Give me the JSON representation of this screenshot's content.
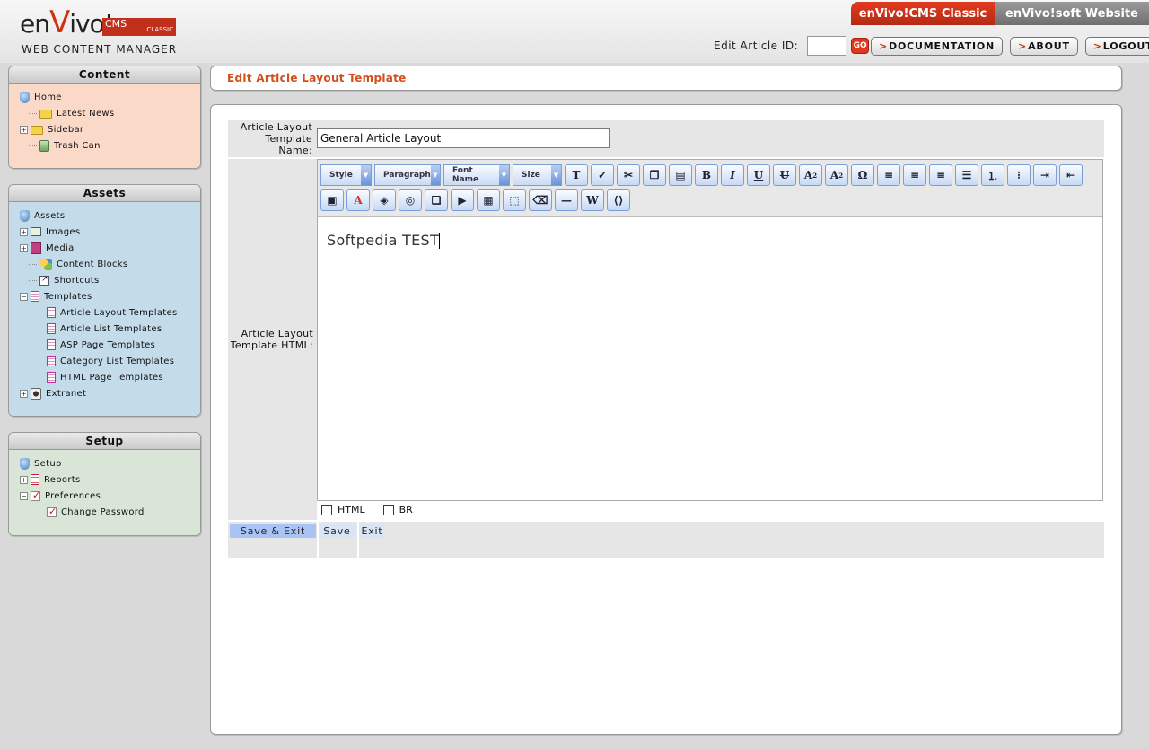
{
  "header": {
    "logo_brand_prefix": "en",
    "logo_brand_v": "V",
    "logo_brand_suffix": "ivo!",
    "logo_cms": "CMS",
    "logo_classic": "CLASSIC",
    "logo_subtitle": "WEB CONTENT MANAGER",
    "site_tabs": [
      "enVivo!CMS Classic",
      "enVivo!soft Website"
    ],
    "edit_article_label": "Edit Article ID:",
    "edit_article_value": "",
    "go_label": "GO",
    "nav_buttons": [
      "DOCUMENTATION",
      "ABOUT",
      "LOGOUT"
    ],
    "nav_arrow": ">"
  },
  "sidebar": {
    "content": {
      "title": "Content",
      "items": [
        "Home",
        "Latest News",
        "Sidebar",
        "Trash Can"
      ]
    },
    "assets": {
      "title": "Assets",
      "items": [
        "Assets",
        "Images",
        "Media",
        "Content Blocks",
        "Shortcuts",
        "Templates",
        "Article Layout Templates",
        "Article List Templates",
        "ASP Page Templates",
        "Category List Templates",
        "HTML Page Templates",
        "Extranet"
      ]
    },
    "setup": {
      "title": "Setup",
      "items": [
        "Setup",
        "Reports",
        "Preferences",
        "Change Password"
      ]
    }
  },
  "main": {
    "title": "Edit Article Layout Template",
    "name_label": "Article Layout Template Name:",
    "name_value": "General Article Layout",
    "html_label": "Article Layout Template HTML:",
    "toolbar_dropdowns": [
      "Style",
      "Paragraph",
      "Font Name",
      "Size"
    ],
    "editor_text": "Softpedia TEST",
    "mode_checkboxes": [
      "HTML",
      "BR"
    ],
    "buttons": [
      "Save & Exit",
      "Save",
      "Exit"
    ]
  },
  "colors": {
    "accent": "#d24f1a",
    "content_panel_bg": "#fbd9c9",
    "assets_panel_bg": "#c4dcea",
    "setup_panel_bg": "#d9e6d7"
  }
}
